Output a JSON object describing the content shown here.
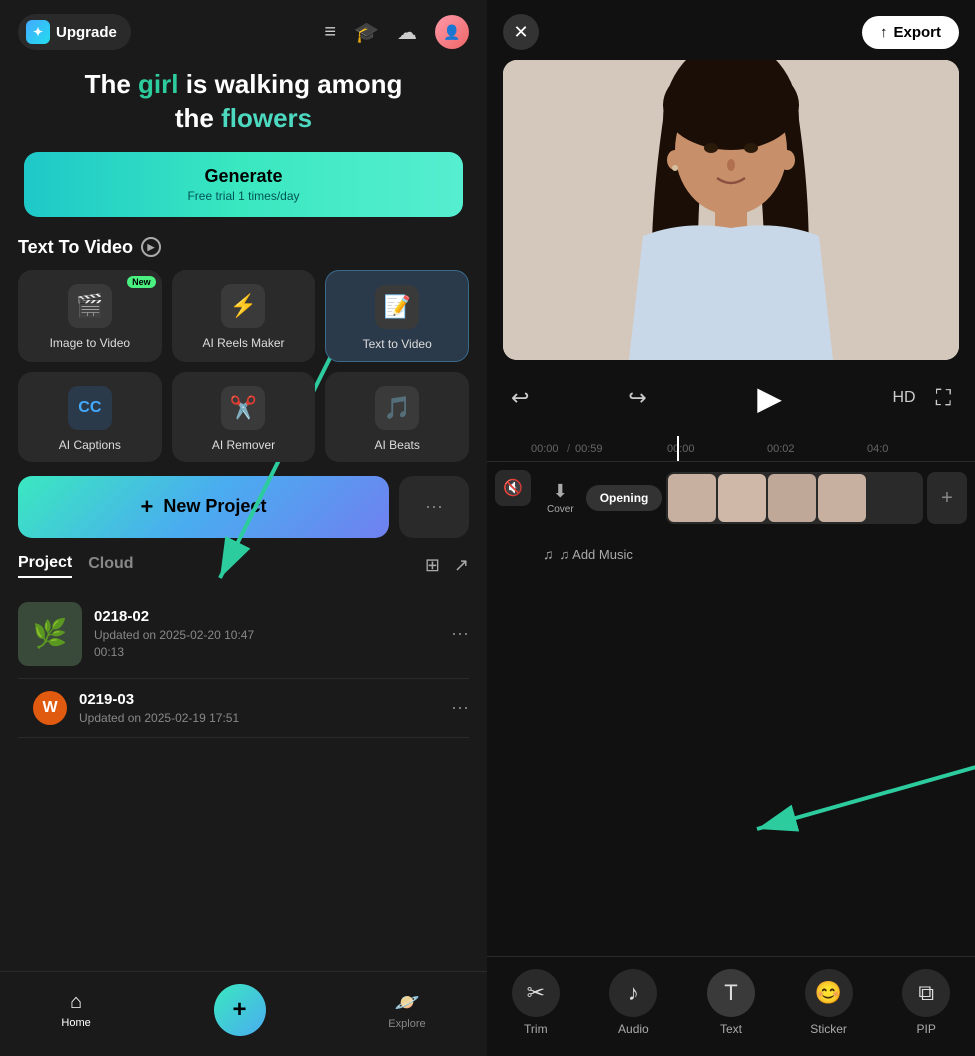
{
  "leftPanel": {
    "upgrade": "Upgrade",
    "heroText": {
      "line1": "The ",
      "girl": "girl",
      "mid": " is walking among",
      "line2": "the ",
      "flowers": "flowers"
    },
    "generateBtn": {
      "label": "Generate",
      "sub": "Free trial 1 times/day"
    },
    "sectionTitle": "Text To Video",
    "tools": [
      {
        "icon": "🎬",
        "label": "Image to Video",
        "badge": "New",
        "highlighted": false
      },
      {
        "icon": "⚡",
        "label": "AI Reels Maker",
        "badge": "",
        "highlighted": false
      },
      {
        "icon": "📝",
        "label": "Text  to Video",
        "badge": "",
        "highlighted": true
      }
    ],
    "tools2": [
      {
        "icon": "CC",
        "label": "AI Captions",
        "badge": ""
      },
      {
        "icon": "✂️",
        "label": "AI Remover",
        "badge": ""
      },
      {
        "icon": "🎵",
        "label": "AI Beats",
        "badge": ""
      }
    ],
    "newProject": "New Project",
    "more": "···",
    "tabs": [
      "Project",
      "Cloud"
    ],
    "projects": [
      {
        "name": "0218-02",
        "date": "Updated on 2025-02-20 10:47",
        "duration": "00:13"
      },
      {
        "name": "0219-03",
        "date": "Updated on 2025-02-19 17:51",
        "duration": ""
      }
    ],
    "nav": {
      "home": "Home",
      "explore": "Explore"
    }
  },
  "rightPanel": {
    "closeBtn": "✕",
    "exportBtn": "Export",
    "timecodes": {
      "current": "00:00",
      "total": "00:59",
      "t0": "00:00",
      "t1": "00:02",
      "t2": "04:0"
    },
    "tracks": {
      "coverLabel": "Cover",
      "openingLabel": "Opening",
      "addMusicLabel": "♫ Add Music"
    },
    "toolbar": {
      "trim": "Trim",
      "audio": "Audio",
      "text": "Text",
      "sticker": "Sticker",
      "pip": "PIP"
    }
  }
}
